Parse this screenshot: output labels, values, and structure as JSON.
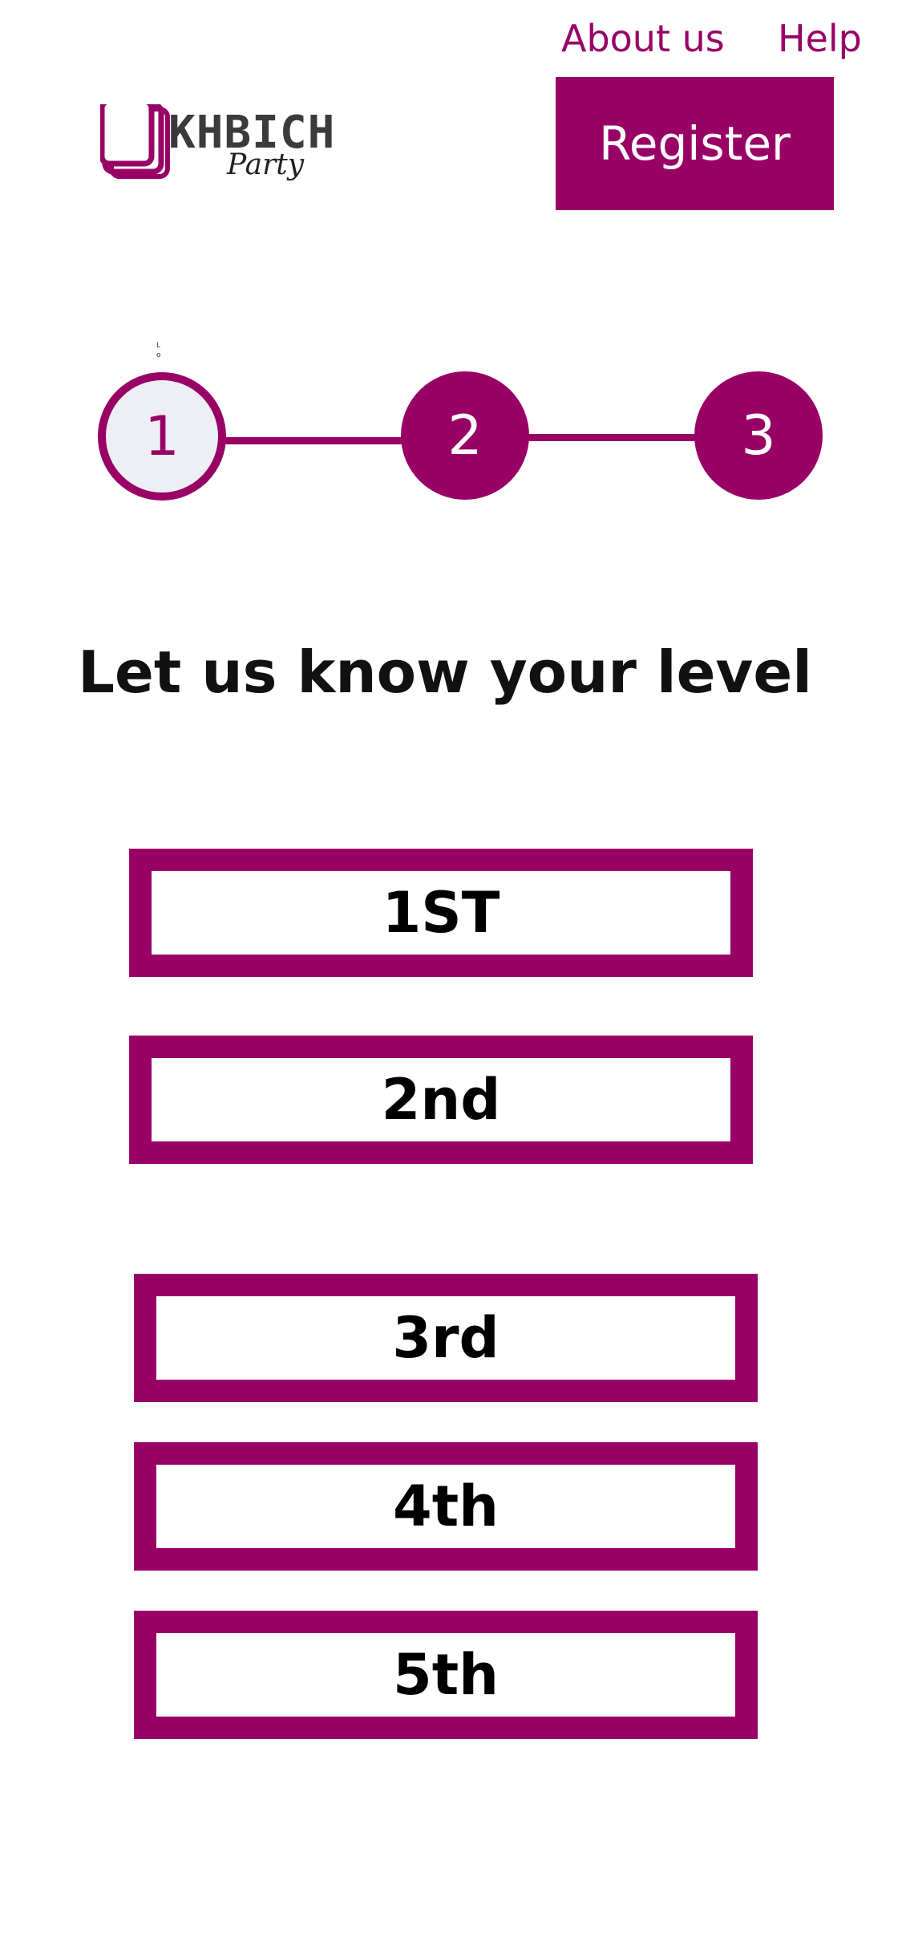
{
  "nav": {
    "about_label": "About us",
    "help_label": "Help",
    "register_label": "Register"
  },
  "logo": {
    "wordmark": "KHBICH",
    "subtitle": "Party"
  },
  "stepper": {
    "steps": [
      {
        "label": "1",
        "state": "active"
      },
      {
        "label": "2",
        "state": "pending"
      },
      {
        "label": "3",
        "state": "pending"
      }
    ],
    "tiny_label": "Lo"
  },
  "title": "Let us know your level",
  "levels": [
    "1ST",
    "2nd",
    "3rd",
    "4th",
    "5th"
  ],
  "colors": {
    "accent": "#990066",
    "active_step_fill": "#eeeef5",
    "text": "#000000"
  }
}
